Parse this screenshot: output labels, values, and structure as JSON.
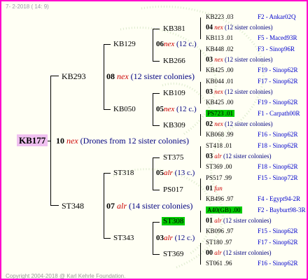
{
  "top_note": "7- 2-2018 ( 14: 9)",
  "copyright": "Copyright 2004-2018 @ Karl Kehrle Foundation.",
  "root": "KB177",
  "root_desc": {
    "num": "10",
    "word": "nex",
    "note": "(Drones from 12 sister colonies)"
  },
  "gen1": [
    {
      "name": "KB293",
      "num": "08",
      "word": "nex",
      "note": "(12 sister colonies)"
    },
    {
      "name": "ST348",
      "num": "07",
      "word": "alr",
      "note": "(14 sister colonies)"
    }
  ],
  "gen2": [
    {
      "name": "KB129",
      "num": "06",
      "word": "nex",
      "note": "(12 c.)"
    },
    {
      "name": "KB050",
      "num": "05",
      "word": "nex",
      "note": "(12 c.)"
    },
    {
      "name": "ST318",
      "num": "05",
      "word": "alr",
      "note": "(13 c.)"
    },
    {
      "name": "ST343",
      "num": "03",
      "word": "alr",
      "note": "(12 c.)"
    }
  ],
  "gen3": [
    {
      "name": "KB381",
      "hl": false
    },
    {
      "name": "KB266",
      "hl": false
    },
    {
      "name": "KB109",
      "hl": false
    },
    {
      "name": "KB309",
      "hl": false
    },
    {
      "name": "ST375",
      "hl": false
    },
    {
      "name": "PS017",
      "hl": false
    },
    {
      "name": "ST308",
      "hl": true
    },
    {
      "name": "ST369",
      "hl": false
    }
  ],
  "gen4": [
    {
      "top": "KB223 .03",
      "top_hl": false,
      "mid_num": "04",
      "mid_word": "nex",
      "mid_note": "(12 sister colonies)",
      "bot": "KB113 .01",
      "top_right": "F2 - Ankar02Q",
      "bot_right": "F5 - Maced93R"
    },
    {
      "top": "KB448 .02",
      "top_hl": false,
      "mid_num": "03",
      "mid_word": "nex",
      "mid_note": "(12 sister colonies)",
      "bot": "KB425 .00",
      "top_right": "F3 - Sinop96R",
      "bot_right": "F19 - Sinop62R"
    },
    {
      "top": "KB044 .01",
      "top_hl": false,
      "mid_num": "03",
      "mid_word": "nex",
      "mid_note": "(12 sister colonies)",
      "bot": "KB425 .00",
      "top_right": "F17 - Sinop62R",
      "bot_right": "F19 - Sinop62R"
    },
    {
      "top": "PS723 .01",
      "top_hl": true,
      "mid_num": "02",
      "mid_word": "nex",
      "mid_note": "(12 sister colonies)",
      "bot": "KB068 .99",
      "top_right": "F1 - Carpath00R",
      "bot_right": "F16 - Sinop62R"
    },
    {
      "top": "ST418 .01",
      "top_hl": false,
      "mid_num": "03",
      "mid_word": "alr",
      "mid_note": "(12 sister colonies)",
      "bot": "ST369 .00",
      "top_right": "F18 - Sinop62R",
      "bot_right": "F18 - Sinop62R"
    },
    {
      "top": "PS517 .99",
      "top_hl": false,
      "mid_num": "01",
      "mid_word": "fun",
      "mid_note": "",
      "bot": "KB496 .97",
      "top_right": "F15 - Sinop72R",
      "bot_right": "F4 - Egypt94-2R"
    },
    {
      "top": "A40(GB) .00",
      "top_hl": true,
      "mid_num": "01",
      "mid_word": "alr",
      "mid_note": "(12 sister colonies)",
      "bot": "KB096 .97",
      "top_right": "F2 - Bayburt98-3R",
      "bot_right": "F15 - Sinop62R"
    },
    {
      "top": "ST180 .97",
      "top_hl": false,
      "mid_num": "00",
      "mid_word": "alr",
      "mid_note": "(12 sister colonies)",
      "bot": "ST061 .96",
      "top_right": "F17 - Sinop62R",
      "bot_right": "F16 - Sinop62R"
    }
  ]
}
